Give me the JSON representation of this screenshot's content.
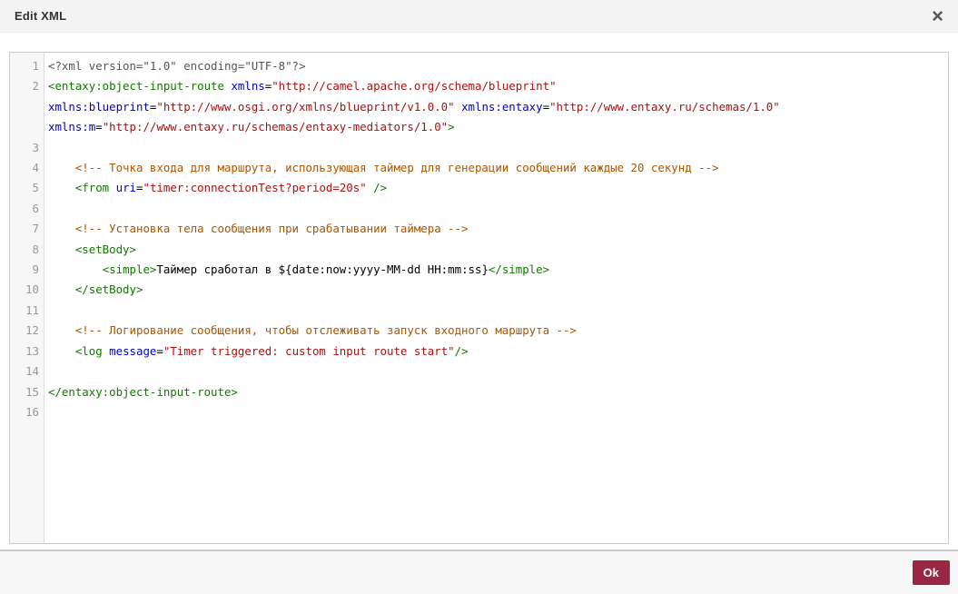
{
  "modal": {
    "title": "Edit XML",
    "close_icon": "×"
  },
  "footer": {
    "ok_label": "Ok"
  },
  "colors": {
    "accent": "#9a2742",
    "tag": "#117700",
    "attr": "#0000cc",
    "str": "#aa1111",
    "com": "#aa5500",
    "meta": "#555555"
  },
  "editor": {
    "language": "xml",
    "lines": [
      {
        "n": "1",
        "tokens": [
          [
            "meta",
            "<?xml version=\"1.0\" encoding=\"UTF-8\"?>"
          ]
        ]
      },
      {
        "n": "2",
        "tokens": [
          [
            "tag",
            "<entaxy:object-input-route"
          ],
          [
            "txt",
            " "
          ],
          [
            "attr",
            "xmlns"
          ],
          [
            "txt",
            "="
          ],
          [
            "str",
            "\"http://camel.apache.org/schema/blueprint\""
          ],
          [
            "txt",
            " "
          ],
          [
            "attr",
            "xmlns:blueprint"
          ],
          [
            "txt",
            "="
          ],
          [
            "str",
            "\"http://www.osgi.org/xmlns/blueprint/v1.0.0\""
          ],
          [
            "txt",
            " "
          ],
          [
            "attr",
            "xmlns:entaxy"
          ],
          [
            "txt",
            "="
          ],
          [
            "str",
            "\"http://www.entaxy.ru/schemas/1.0\""
          ],
          [
            "txt",
            " "
          ],
          [
            "attr",
            "xmlns:m"
          ],
          [
            "txt",
            "="
          ],
          [
            "str",
            "\"http://www.entaxy.ru/schemas/entaxy-mediators/1.0\""
          ],
          [
            "tag",
            ">"
          ]
        ]
      },
      {
        "n": "3",
        "tokens": []
      },
      {
        "n": "4",
        "tokens": [
          [
            "txt",
            "    "
          ],
          [
            "com",
            "<!-- Точка входа для маршрута, использующая таймер для генерации сообщений каждые 20 секунд -->"
          ]
        ]
      },
      {
        "n": "5",
        "tokens": [
          [
            "txt",
            "    "
          ],
          [
            "tag",
            "<from"
          ],
          [
            "txt",
            " "
          ],
          [
            "attr",
            "uri"
          ],
          [
            "txt",
            "="
          ],
          [
            "str",
            "\"timer:connectionTest?period=20s\""
          ],
          [
            "txt",
            " "
          ],
          [
            "tag",
            "/>"
          ]
        ]
      },
      {
        "n": "6",
        "tokens": []
      },
      {
        "n": "7",
        "tokens": [
          [
            "txt",
            "    "
          ],
          [
            "com",
            "<!-- Установка тела сообщения при срабатывании таймера -->"
          ]
        ]
      },
      {
        "n": "8",
        "tokens": [
          [
            "txt",
            "    "
          ],
          [
            "tag",
            "<setBody>"
          ]
        ]
      },
      {
        "n": "9",
        "tokens": [
          [
            "txt",
            "        "
          ],
          [
            "tag",
            "<simple>"
          ],
          [
            "txt",
            "Таймер сработал в ${date:now:yyyy-MM-dd HH:mm:ss}"
          ],
          [
            "tag",
            "</simple>"
          ]
        ]
      },
      {
        "n": "10",
        "tokens": [
          [
            "txt",
            "    "
          ],
          [
            "tag",
            "</setBody>"
          ]
        ]
      },
      {
        "n": "11",
        "tokens": []
      },
      {
        "n": "12",
        "tokens": [
          [
            "txt",
            "    "
          ],
          [
            "com",
            "<!-- Логирование сообщения, чтобы отслеживать запуск входного маршрута -->"
          ]
        ]
      },
      {
        "n": "13",
        "tokens": [
          [
            "txt",
            "    "
          ],
          [
            "tag",
            "<log"
          ],
          [
            "txt",
            " "
          ],
          [
            "attr",
            "message"
          ],
          [
            "txt",
            "="
          ],
          [
            "str",
            "\"Timer triggered: custom input route start\""
          ],
          [
            "tag",
            "/>"
          ]
        ]
      },
      {
        "n": "14",
        "tokens": []
      },
      {
        "n": "15",
        "tokens": [
          [
            "tag",
            "</entaxy:object-input-route>"
          ]
        ]
      },
      {
        "n": "16",
        "tokens": []
      }
    ]
  }
}
